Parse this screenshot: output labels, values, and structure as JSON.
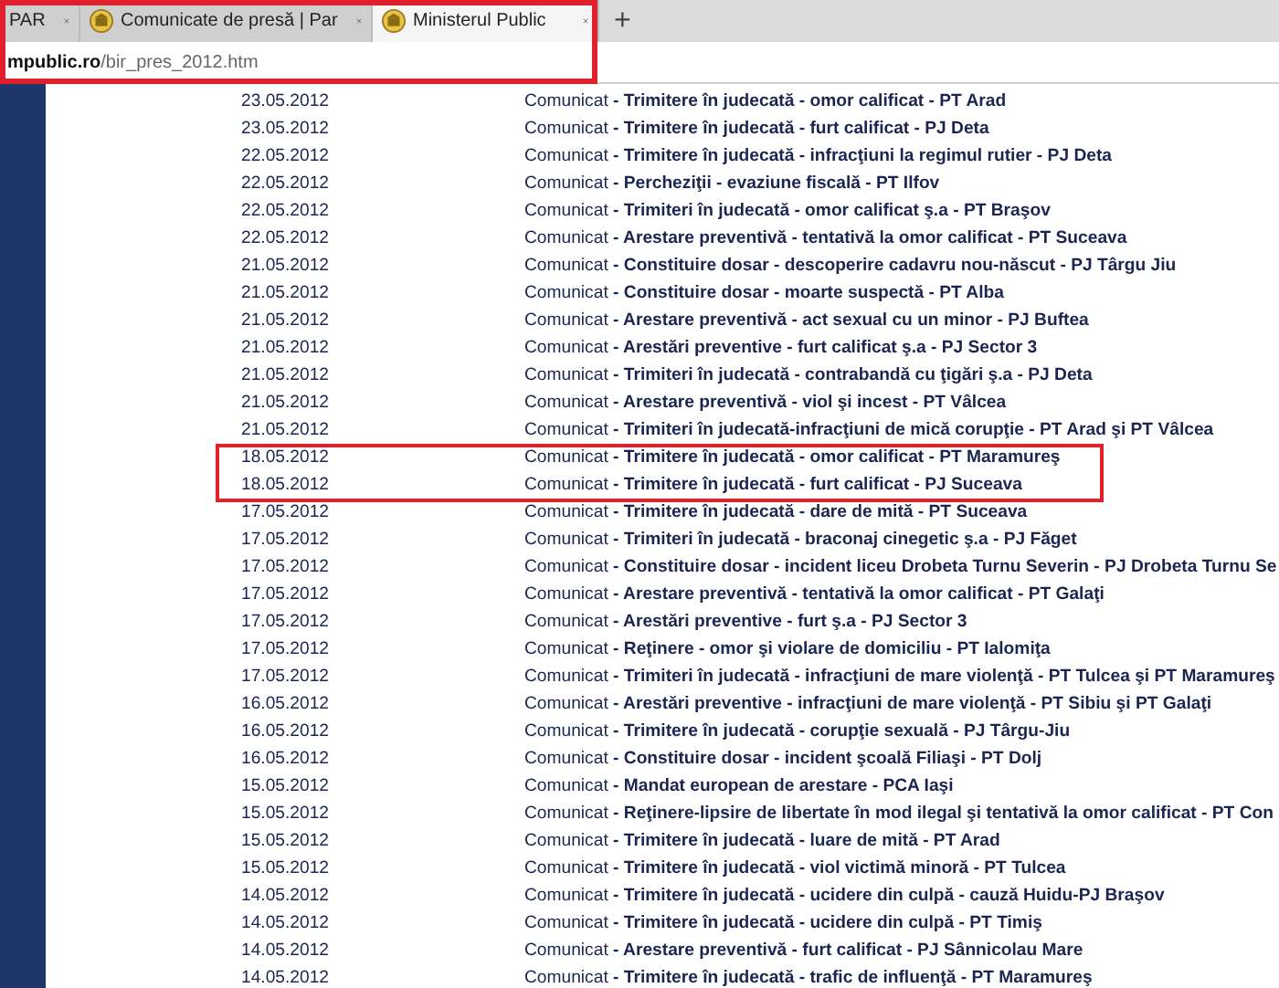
{
  "browser": {
    "annotated": true,
    "tabs": [
      {
        "label": "PAR",
        "favicon": false,
        "selected": false
      },
      {
        "label": "Comunicate de presă | Par",
        "favicon": true,
        "selected": false
      },
      {
        "label": "Ministerul Public",
        "favicon": true,
        "selected": true
      }
    ],
    "new_tab": "+",
    "address": {
      "domain": "mpublic.ro",
      "path": "/bir_pres_2012.htm"
    }
  },
  "rows": [
    {
      "date": "23.05.2012",
      "text": "Comunicat **- Trimitere în judecată - omor calificat - PT Arad**",
      "annotated": false
    },
    {
      "date": "23.05.2012",
      "text": "Comunicat **- Trimitere în judecată - furt calificat - PJ Deta**",
      "annotated": false
    },
    {
      "date": "22.05.2012",
      "text": "Comunicat **- Trimitere în judecată - infracţiuni la regimul rutier - PJ Deta**",
      "annotated": false
    },
    {
      "date": "22.05.2012",
      "text": "Comunicat **- Percheziţii - evaziune fiscală - PT Ilfov**",
      "annotated": false
    },
    {
      "date": "22.05.2012",
      "text": "Comunicat **- Trimiteri în judecată - omor calificat ş.a - PT Braşov**",
      "annotated": false
    },
    {
      "date": "22.05.2012",
      "text": "Comunicat **- Arestare preventivă - tentativă la omor calificat - PT Suceava**",
      "annotated": false
    },
    {
      "date": "21.05.2012",
      "text": "Comunicat **- Constituire dosar - descoperire cadavru nou-născut - PJ Târgu Jiu**",
      "annotated": false
    },
    {
      "date": "21.05.2012",
      "text": "Comunicat **- Constituire dosar - moarte suspectă - PT Alba**",
      "annotated": false
    },
    {
      "date": "21.05.2012",
      "text": "Comunicat **- Arestare preventivă - act sexual cu un minor - PJ Buftea**",
      "annotated": false
    },
    {
      "date": "21.05.2012",
      "text": "Comunicat **- Arestări preventive - furt calificat ş.a - PJ Sector 3**",
      "annotated": false
    },
    {
      "date": "21.05.2012",
      "text": "Comunicat **- Trimiteri în judecată - contrabandă cu ţigări ş.a - PJ Deta**",
      "annotated": false
    },
    {
      "date": "21.05.2012",
      "text": "Comunicat **- Arestare preventivă - viol şi incest - PT Vâlcea**",
      "annotated": false
    },
    {
      "date": "21.05.2012",
      "text": "Comunicat **- Trimiteri în judecată-infracţiuni de mică corupţie - PT Arad şi PT Vâlcea**",
      "annotated": false
    },
    {
      "date": "18.05.2012",
      "text": "Comunicat **- Trimitere în judecată - omor calificat - PT Maramureş**",
      "annotated": true
    },
    {
      "date": "18.05.2012",
      "text": "Comunicat **- Trimitere în judecată - furt calificat - PJ Suceava**",
      "annotated": true
    },
    {
      "date": "17.05.2012",
      "text": "Comunicat **- Trimitere în judecată - dare de mită - PT Suceava**",
      "annotated": false
    },
    {
      "date": "17.05.2012",
      "text": "Comunicat **- Trimiteri în judecată - braconaj cinegetic ş.a - PJ Făget**",
      "annotated": false
    },
    {
      "date": "17.05.2012",
      "text": "Comunicat **- Constituire dosar - incident liceu Drobeta Turnu Severin - PJ Drobeta Turnu Se**",
      "annotated": false
    },
    {
      "date": "17.05.2012",
      "text": "Comunicat **- Arestare preventivă - tentativă la omor calificat - PT Galaţi**",
      "annotated": false
    },
    {
      "date": "17.05.2012",
      "text": "Comunicat **- Arestări preventive - furt ş.a - PJ Sector 3**",
      "annotated": false
    },
    {
      "date": "17.05.2012",
      "text": "Comunicat **- Reţinere - omor şi violare de domiciliu - PT Ialomiţa**",
      "annotated": false
    },
    {
      "date": "17.05.2012",
      "text": "Comunicat **- Trimiteri în judecată - infracţiuni de mare violenţă - PT Tulcea şi PT Maramureş**",
      "annotated": false
    },
    {
      "date": "16.05.2012",
      "text": "Comunicat **- Arestări preventive - infracţiuni de mare violenţă - PT Sibiu şi PT Galaţi**",
      "annotated": false
    },
    {
      "date": "16.05.2012",
      "text": "Comunicat **- Trimitere în judecată - corupţie sexuală - PJ Târgu-Jiu**",
      "annotated": false
    },
    {
      "date": "16.05.2012",
      "text": "Comunicat **- Constituire dosar - incident şcoală Filiaşi - PT Dolj**",
      "annotated": false
    },
    {
      "date": "15.05.2012",
      "text": "Comunicat **- Mandat european de arestare - PCA Iaşi**",
      "annotated": false
    },
    {
      "date": "15.05.2012",
      "text": "Comunicat **- Reţinere-lipsire de libertate în mod ilegal şi tentativă la omor calificat - PT Con**",
      "annotated": false
    },
    {
      "date": "15.05.2012",
      "text": "Comunicat **- Trimitere în judecată - luare de mită - PT Arad**",
      "annotated": false
    },
    {
      "date": "15.05.2012",
      "text": "Comunicat **- Trimitere în judecată - viol victimă minoră - PT Tulcea**",
      "annotated": false
    },
    {
      "date": "14.05.2012",
      "text": "Comunicat **- Trimitere în judecată - ucidere din culpă - cauză Huidu-PJ Braşov**",
      "annotated": false
    },
    {
      "date": "14.05.2012",
      "text": "Comunicat **- Trimitere în judecată - ucidere din culpă - PT Timiş**",
      "annotated": false
    },
    {
      "date": "14.05.2012",
      "text": "Comunicat **- Arestare preventivă - furt calificat - PJ Sânnicolau Mare**",
      "annotated": false
    },
    {
      "date": "14.05.2012",
      "text": "Comunicat **- Trimitere în judecată - trafic de influenţă - PT Maramureş**",
      "annotated": false
    }
  ]
}
